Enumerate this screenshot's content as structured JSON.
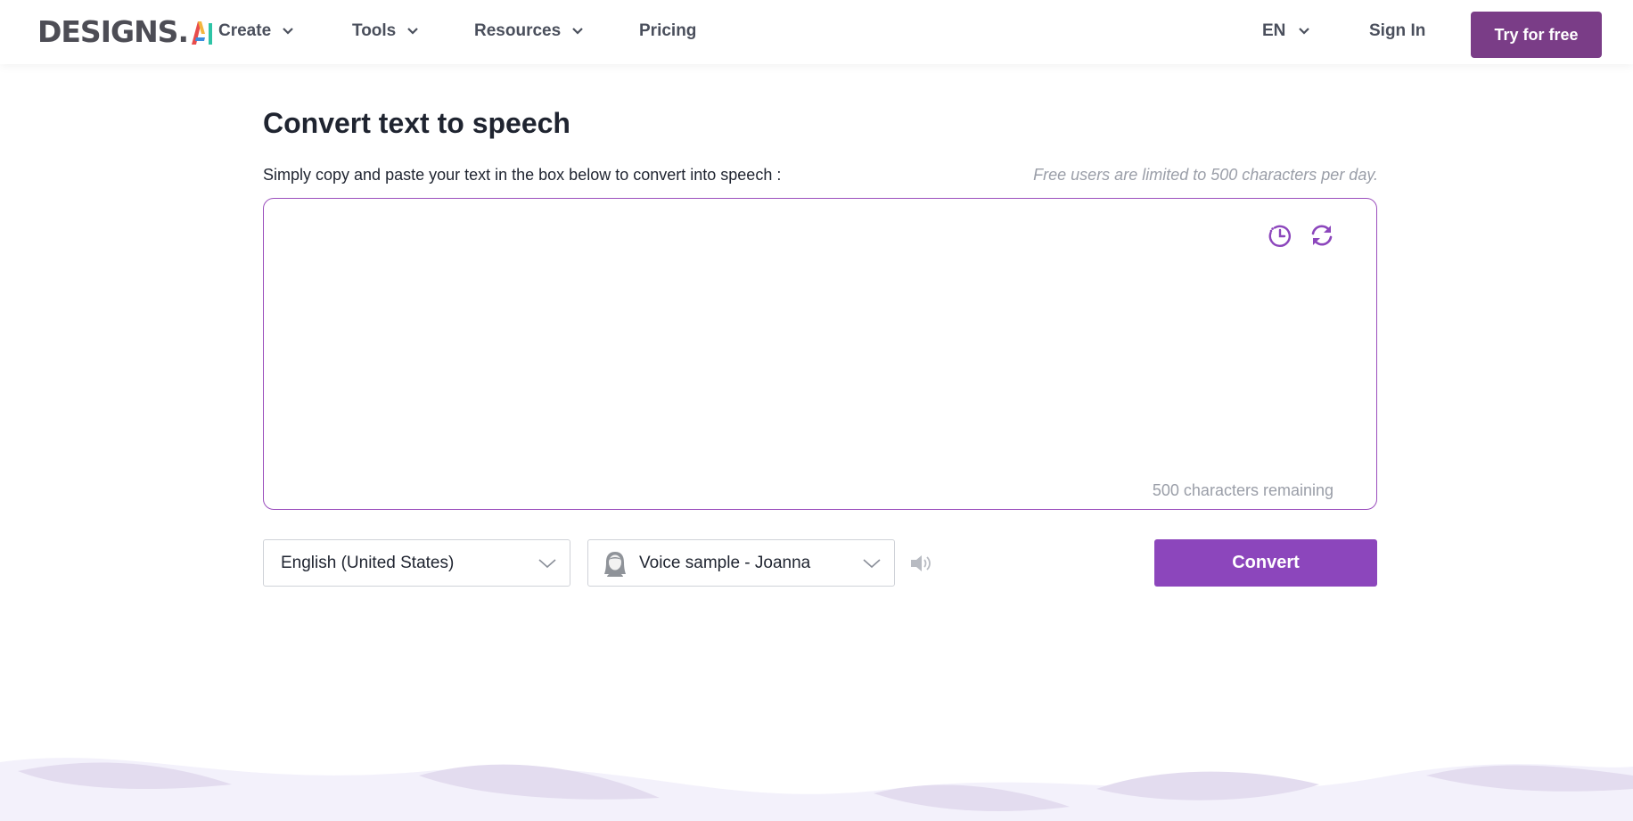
{
  "header": {
    "logo_text": "DESIGNS.",
    "logo_ai": "AI",
    "nav": [
      {
        "label": "Create",
        "has_dropdown": true
      },
      {
        "label": "Tools",
        "has_dropdown": true
      },
      {
        "label": "Resources",
        "has_dropdown": true
      },
      {
        "label": "Pricing",
        "has_dropdown": false
      }
    ],
    "language": "EN",
    "sign_in": "Sign In",
    "try_free": "Try for free"
  },
  "main": {
    "title": "Convert text to speech",
    "instruction": "Simply copy and paste your text in the box below to convert into speech :",
    "limit_note": "Free users are limited to 500 characters per day.",
    "textarea_value": "",
    "remaining": "500 characters remaining",
    "language_select": "English (United States)",
    "voice_select": "Voice sample - Joanna",
    "convert": "Convert"
  },
  "icons": {
    "history": "history-icon",
    "refresh": "refresh-icon",
    "speaker": "speaker-icon",
    "avatar": "avatar-icon",
    "chevron": "chevron-down-icon"
  },
  "colors": {
    "brand": "#7a3d87",
    "accent": "#8c46bc",
    "border_accent": "#9b4fbd",
    "wave_light": "#f3f1fb",
    "wave_dark": "#e3dcef"
  }
}
